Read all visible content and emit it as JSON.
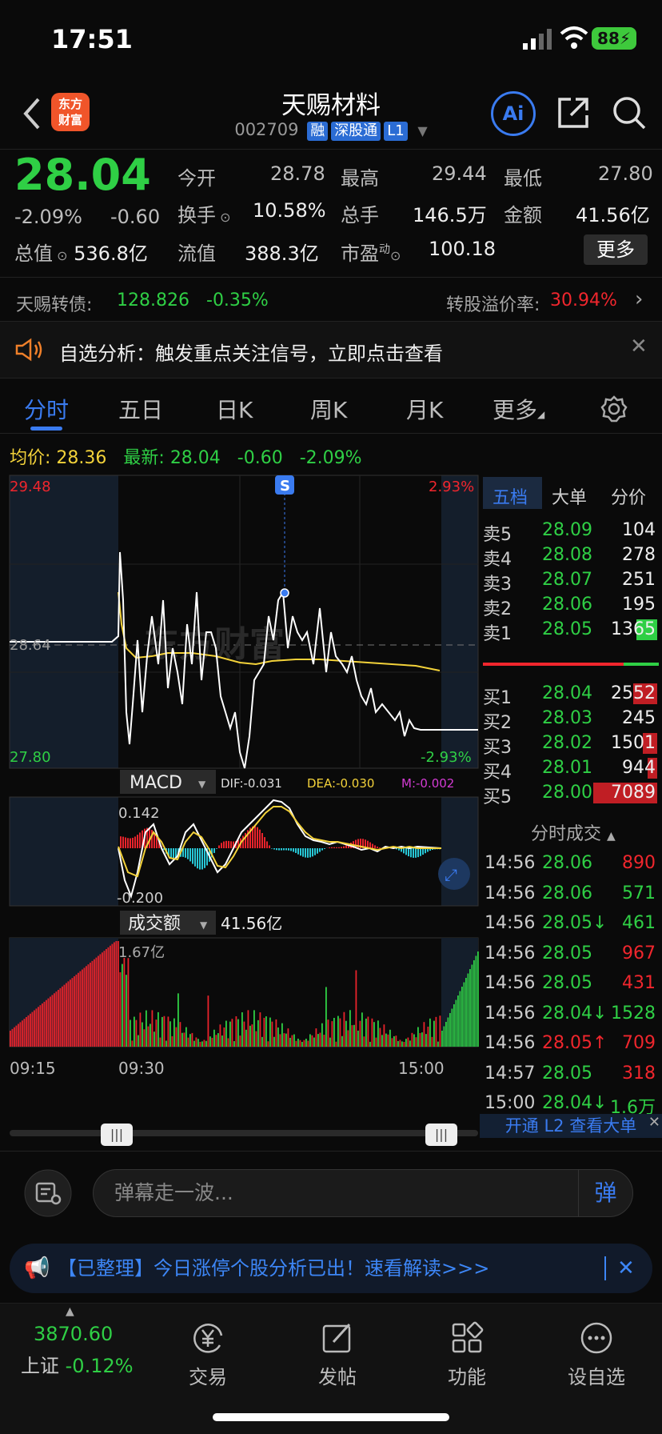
{
  "status": {
    "time": "17:51",
    "battery": "88"
  },
  "header": {
    "logo_line1": "东方",
    "logo_line2": "财富",
    "name": "天赐材料",
    "code": "002709",
    "tags": [
      "融",
      "深股通",
      "L1"
    ],
    "ai_label": "Ai"
  },
  "quote": {
    "price": "28.04",
    "change_pct": "-2.09%",
    "change": "-0.60",
    "open_label": "今开",
    "open": "28.78",
    "high_label": "最高",
    "high": "29.44",
    "low_label": "最低",
    "low": "27.80",
    "turnover_label": "换手",
    "turnover": "10.58%",
    "volume_label": "总手",
    "volume": "146.5万",
    "amount_label": "金额",
    "amount": "41.56亿",
    "mktcap_label": "总值",
    "mktcap": "536.8亿",
    "float_label": "流值",
    "float": "388.3亿",
    "pe_label": "市盈",
    "pe_sup": "动",
    "pe": "100.18",
    "more": "更多"
  },
  "bond": {
    "label": "天赐转债:",
    "price": "128.826",
    "pct": "-0.35%",
    "premium_label": "转股溢价率:",
    "premium": "30.94%"
  },
  "notice": {
    "text": "自选分析：触发重点关注信号，立即点击查看"
  },
  "tabs": [
    "分时",
    "五日",
    "日K",
    "周K",
    "月K",
    "更多"
  ],
  "avg": {
    "label": "均价:",
    "value": "28.36",
    "latest_label": "最新:",
    "latest": "28.04",
    "chg": "-0.60",
    "pct": "-2.09%"
  },
  "chart_labels": {
    "top_price": "29.48",
    "bottom_price": "27.80",
    "mid_price": "28.64",
    "top_pct": "2.93%",
    "bottom_pct": "-2.93%",
    "signal": "S",
    "watermark": "东方财富"
  },
  "macd": {
    "name": "MACD",
    "dif": "DIF:-0.031",
    "dea": "DEA:-0.030",
    "m": "M:-0.002",
    "top": "0.142",
    "bottom": "-0.200"
  },
  "amount_panel": {
    "name": "成交额",
    "total": "41.56亿",
    "scale": "1.67亿"
  },
  "time_axis": [
    "09:15",
    "09:30",
    "15:00"
  ],
  "book": {
    "tabs": [
      "五档",
      "大单",
      "分价"
    ],
    "asks": [
      {
        "label": "卖5",
        "price": "28.09",
        "vol": "104"
      },
      {
        "label": "卖4",
        "price": "28.08",
        "vol": "278"
      },
      {
        "label": "卖3",
        "price": "28.07",
        "vol": "251"
      },
      {
        "label": "卖2",
        "price": "28.06",
        "vol": "195"
      },
      {
        "label": "卖1",
        "price": "28.05",
        "vol": "1365"
      }
    ],
    "bids": [
      {
        "label": "买1",
        "price": "28.04",
        "vol": "2552"
      },
      {
        "label": "买2",
        "price": "28.03",
        "vol": "245"
      },
      {
        "label": "买3",
        "price": "28.02",
        "vol": "1501"
      },
      {
        "label": "买4",
        "price": "28.01",
        "vol": "944"
      },
      {
        "label": "买5",
        "price": "28.00",
        "vol": "7089"
      }
    ],
    "ticks_title": "分时成交",
    "ticks": [
      {
        "t": "14:56",
        "p": "28.06",
        "v": "890",
        "c": "red"
      },
      {
        "t": "14:56",
        "p": "28.06",
        "v": "571",
        "c": "green"
      },
      {
        "t": "14:56",
        "p": "28.05↓",
        "v": "461",
        "c": "green"
      },
      {
        "t": "14:56",
        "p": "28.05",
        "v": "967",
        "c": "red"
      },
      {
        "t": "14:56",
        "p": "28.05",
        "v": "431",
        "c": "red"
      },
      {
        "t": "14:56",
        "p": "28.04↓",
        "v": "1528",
        "c": "green"
      },
      {
        "t": "14:56",
        "p": "28.05↑",
        "v": "709",
        "c": "red"
      },
      {
        "t": "14:57",
        "p": "28.05",
        "v": "318",
        "c": "red"
      },
      {
        "t": "15:00",
        "p": "28.04↓",
        "v": "1.6万",
        "c": "green"
      }
    ],
    "l2_link": "开通 L2 查看大单"
  },
  "danmu": {
    "placeholder": "弹幕走一波...",
    "send": "弹"
  },
  "promo": {
    "text": "【已整理】今日涨停个股分析已出！速看解读>>>"
  },
  "nav": {
    "index_value": "3870.60",
    "index_name": "上证",
    "index_pct": "-0.12%",
    "items": [
      "交易",
      "发帖",
      "功能",
      "设自选"
    ]
  },
  "colors": {
    "up": "#f0262d",
    "down": "#2fcf45",
    "accent": "#3a7bf0",
    "avg": "#f3d23a"
  }
}
